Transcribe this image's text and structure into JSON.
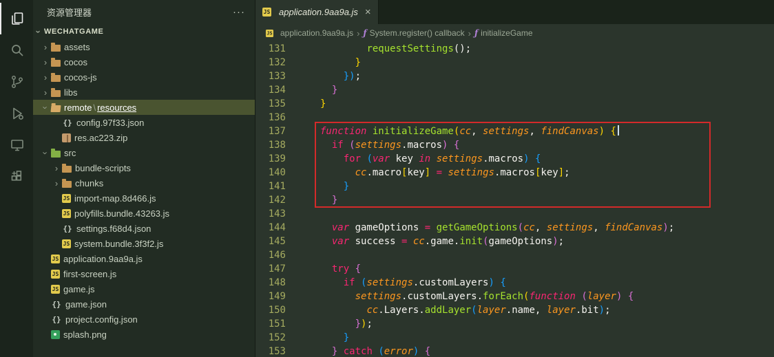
{
  "glyphs": {
    "chevron": "›",
    "more": "···",
    "close": "×",
    "sep": "›"
  },
  "theme": {
    "editor_bg": "#2b352c",
    "sidebar_bg": "#222c23",
    "activity_bg": "#1b241c",
    "selection_bg": "#4a5430",
    "line_number": "#a6ac60",
    "annotation_red": "#d42a2a",
    "keyword": "#f92672",
    "function": "#a6e22e",
    "parameter": "#fd971f"
  },
  "activity_bar": {
    "items": [
      {
        "name": "explorer",
        "active": true
      },
      {
        "name": "search",
        "active": false
      },
      {
        "name": "source-control",
        "active": false
      },
      {
        "name": "run-debug",
        "active": false
      },
      {
        "name": "remote-explorer",
        "active": false
      },
      {
        "name": "extensions",
        "active": false
      }
    ]
  },
  "sidebar": {
    "title": "资源管理器",
    "workspace": "WECHATGAME",
    "tree": [
      {
        "indent": 1,
        "chevron": "collapsed",
        "icon": "folder",
        "label": "assets"
      },
      {
        "indent": 1,
        "chevron": "collapsed",
        "icon": "folder",
        "label": "cocos"
      },
      {
        "indent": 1,
        "chevron": "collapsed",
        "icon": "folder",
        "label": "cocos-js"
      },
      {
        "indent": 1,
        "chevron": "collapsed",
        "icon": "folder",
        "label": "libs"
      },
      {
        "indent": 1,
        "chevron": "expanded",
        "icon": "folder-open",
        "label": "remote",
        "sep": "\\",
        "label2": "resources",
        "selected": true
      },
      {
        "indent": 2,
        "chevron": "none",
        "icon": "json",
        "label": "config.97f33.json"
      },
      {
        "indent": 2,
        "chevron": "none",
        "icon": "zip",
        "label": "res.ac223.zip"
      },
      {
        "indent": 1,
        "chevron": "expanded",
        "icon": "folder-src",
        "label": "src"
      },
      {
        "indent": 2,
        "chevron": "collapsed",
        "icon": "folder",
        "label": "bundle-scripts"
      },
      {
        "indent": 2,
        "chevron": "collapsed",
        "icon": "folder",
        "label": "chunks"
      },
      {
        "indent": 2,
        "chevron": "none",
        "icon": "js",
        "label": "import-map.8d466.js"
      },
      {
        "indent": 2,
        "chevron": "none",
        "icon": "js",
        "label": "polyfills.bundle.43263.js"
      },
      {
        "indent": 2,
        "chevron": "none",
        "icon": "json",
        "label": "settings.f68d4.json"
      },
      {
        "indent": 2,
        "chevron": "none",
        "icon": "js",
        "label": "system.bundle.3f3f2.js"
      },
      {
        "indent": 1,
        "chevron": "none",
        "icon": "js",
        "label": "application.9aa9a.js"
      },
      {
        "indent": 1,
        "chevron": "none",
        "icon": "js",
        "label": "first-screen.js"
      },
      {
        "indent": 1,
        "chevron": "none",
        "icon": "js",
        "label": "game.js"
      },
      {
        "indent": 1,
        "chevron": "none",
        "icon": "json",
        "label": "game.json"
      },
      {
        "indent": 1,
        "chevron": "none",
        "icon": "json",
        "label": "project.config.json"
      },
      {
        "indent": 1,
        "chevron": "none",
        "icon": "img",
        "label": "splash.png"
      }
    ]
  },
  "editor": {
    "tab": {
      "label": "application.9aa9a.js"
    },
    "breadcrumbs": [
      {
        "icon": "js",
        "label": "application.9aa9a.js"
      },
      {
        "icon": "method",
        "label": "System.register() callback"
      },
      {
        "icon": "method",
        "label": "initializeGame"
      }
    ],
    "annotation": {
      "type": "red-box",
      "color": "#d42a2a",
      "first_line": 137,
      "last_line": 143
    },
    "code": {
      "lines": [
        {
          "num": 131,
          "tokens": [
            [
              "        "
            ],
            [
              "requestSettings",
              "fn"
            ],
            [
              "();"
            ]
          ]
        },
        {
          "num": 132,
          "tokens": [
            [
              "      "
            ],
            [
              "}",
              "b1"
            ]
          ]
        },
        {
          "num": 133,
          "tokens": [
            [
              "    "
            ],
            [
              "}",
              "b3"
            ],
            [
              ")",
              "b3"
            ],
            [
              ";"
            ]
          ]
        },
        {
          "num": 134,
          "tokens": [
            [
              "  "
            ],
            [
              "}",
              "b2"
            ]
          ]
        },
        {
          "num": 135,
          "tokens": [
            [
              "}",
              "b1"
            ]
          ]
        },
        {
          "num": 136,
          "tokens": []
        },
        {
          "num": 137,
          "cursor": true,
          "tokens": [
            [
              "function ",
              "kwi"
            ],
            [
              "initializeGame",
              "fn"
            ],
            [
              "(",
              "b1"
            ],
            [
              "cc",
              "pi"
            ],
            [
              ", "
            ],
            [
              "settings",
              "pi"
            ],
            [
              ", "
            ],
            [
              "findCanvas",
              "pi"
            ],
            [
              ")",
              "b1"
            ],
            [
              " "
            ],
            [
              "{",
              "b1"
            ]
          ]
        },
        {
          "num": 138,
          "tokens": [
            [
              "  "
            ],
            [
              "if ",
              "kw"
            ],
            [
              "(",
              "b2"
            ],
            [
              "settings",
              "pi"
            ],
            [
              ".macros"
            ],
            [
              ")",
              "b2"
            ],
            [
              " "
            ],
            [
              "{",
              "b2"
            ]
          ]
        },
        {
          "num": 139,
          "tokens": [
            [
              "    "
            ],
            [
              "for ",
              "kw"
            ],
            [
              "(",
              "b3"
            ],
            [
              "var ",
              "kwi"
            ],
            [
              "key"
            ],
            [
              " "
            ],
            [
              "in",
              "kwi"
            ],
            [
              " "
            ],
            [
              "settings",
              "pi"
            ],
            [
              ".macros"
            ],
            [
              ")",
              "b3"
            ],
            [
              " "
            ],
            [
              "{",
              "b3"
            ]
          ]
        },
        {
          "num": 140,
          "tokens": [
            [
              "      "
            ],
            [
              "cc",
              "pi"
            ],
            [
              ".macro"
            ],
            [
              "[",
              "b1"
            ],
            [
              "key"
            ],
            [
              "]",
              "b1"
            ],
            [
              " "
            ],
            [
              "=",
              "kw"
            ],
            [
              " "
            ],
            [
              "settings",
              "pi"
            ],
            [
              ".macros"
            ],
            [
              "[",
              "b1"
            ],
            [
              "key"
            ],
            [
              "]",
              "b1"
            ],
            [
              ";"
            ]
          ]
        },
        {
          "num": 141,
          "tokens": [
            [
              "    "
            ],
            [
              "}",
              "b3"
            ]
          ]
        },
        {
          "num": 142,
          "tokens": [
            [
              "  "
            ],
            [
              "}",
              "b2"
            ]
          ]
        },
        {
          "num": 143,
          "tokens": []
        },
        {
          "num": 144,
          "tokens": [
            [
              "  "
            ],
            [
              "var ",
              "kwi"
            ],
            [
              "gameOptions "
            ],
            [
              "=",
              "kw"
            ],
            [
              " "
            ],
            [
              "getGameOptions",
              "fn"
            ],
            [
              "(",
              "b2"
            ],
            [
              "cc",
              "pi"
            ],
            [
              ", "
            ],
            [
              "settings",
              "pi"
            ],
            [
              ", "
            ],
            [
              "findCanvas",
              "pi"
            ],
            [
              ")",
              "b2"
            ],
            [
              ";"
            ]
          ]
        },
        {
          "num": 145,
          "tokens": [
            [
              "  "
            ],
            [
              "var ",
              "kwi"
            ],
            [
              "success "
            ],
            [
              "=",
              "kw"
            ],
            [
              " "
            ],
            [
              "cc",
              "pi"
            ],
            [
              ".game."
            ],
            [
              "init",
              "fn"
            ],
            [
              "(",
              "b2"
            ],
            [
              "gameOptions"
            ],
            [
              ")",
              "b2"
            ],
            [
              ";"
            ]
          ]
        },
        {
          "num": 146,
          "tokens": []
        },
        {
          "num": 147,
          "tokens": [
            [
              "  "
            ],
            [
              "try ",
              "kw"
            ],
            [
              "{",
              "b2"
            ]
          ]
        },
        {
          "num": 148,
          "tokens": [
            [
              "    "
            ],
            [
              "if ",
              "kw"
            ],
            [
              "(",
              "b3"
            ],
            [
              "settings",
              "pi"
            ],
            [
              ".customLayers"
            ],
            [
              ")",
              "b3"
            ],
            [
              " "
            ],
            [
              "{",
              "b3"
            ]
          ]
        },
        {
          "num": 149,
          "tokens": [
            [
              "      "
            ],
            [
              "settings",
              "pi"
            ],
            [
              ".customLayers."
            ],
            [
              "forEach",
              "fn"
            ],
            [
              "(",
              "b1"
            ],
            [
              "function ",
              "kwi"
            ],
            [
              "(",
              "b2"
            ],
            [
              "layer",
              "pi"
            ],
            [
              ")",
              "b2"
            ],
            [
              " "
            ],
            [
              "{",
              "b2"
            ]
          ]
        },
        {
          "num": 150,
          "tokens": [
            [
              "        "
            ],
            [
              "cc",
              "pi"
            ],
            [
              ".Layers."
            ],
            [
              "addLayer",
              "fn"
            ],
            [
              "(",
              "b3"
            ],
            [
              "layer",
              "pi"
            ],
            [
              ".name"
            ],
            [
              ", "
            ],
            [
              "layer",
              "pi"
            ],
            [
              ".bit"
            ],
            [
              ")",
              "b3"
            ],
            [
              ";"
            ]
          ]
        },
        {
          "num": 151,
          "tokens": [
            [
              "      "
            ],
            [
              "}",
              "b2"
            ],
            [
              ")",
              "b1"
            ],
            [
              ";"
            ]
          ]
        },
        {
          "num": 152,
          "tokens": [
            [
              "    "
            ],
            [
              "}",
              "b3"
            ]
          ]
        },
        {
          "num": 153,
          "tokens": [
            [
              "  "
            ],
            [
              "}",
              "b2"
            ],
            [
              " "
            ],
            [
              "catch ",
              "kw"
            ],
            [
              "(",
              "b3"
            ],
            [
              "error",
              "pi"
            ],
            [
              ")",
              "b3"
            ],
            [
              " "
            ],
            [
              "{",
              "b2"
            ]
          ]
        }
      ]
    }
  }
}
